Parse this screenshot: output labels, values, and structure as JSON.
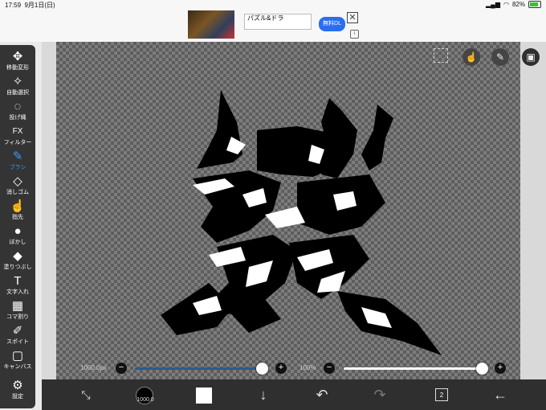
{
  "status_bar": {
    "time": "17:59",
    "date": "9月1日(日)",
    "battery": "82%"
  },
  "ad": {
    "title": "パズル&ドラ",
    "button": "無料DL",
    "close": "✕",
    "info": "i"
  },
  "tools": [
    {
      "name": "move",
      "label": "移動変形",
      "icon": "✥"
    },
    {
      "name": "magic-wand",
      "label": "自動選択",
      "icon": "✧"
    },
    {
      "name": "lasso",
      "label": "投げ縄",
      "icon": "◌"
    },
    {
      "name": "filter",
      "label": "フィルター",
      "icon": "FX"
    },
    {
      "name": "brush",
      "label": "ブラシ",
      "icon": "✎"
    },
    {
      "name": "eraser",
      "label": "消しゴム",
      "icon": "◇"
    },
    {
      "name": "finger",
      "label": "指先",
      "icon": "☝"
    },
    {
      "name": "blur",
      "label": "ぼかし",
      "icon": "●"
    },
    {
      "name": "fill",
      "label": "塗りつぶし",
      "icon": "◆"
    },
    {
      "name": "text",
      "label": "文字入れ",
      "icon": "T"
    },
    {
      "name": "panel",
      "label": "コマ割り",
      "icon": "▦"
    },
    {
      "name": "eyedropper",
      "label": "スポイト",
      "icon": "✐"
    },
    {
      "name": "canvas",
      "label": "キャンバス",
      "icon": "▢"
    },
    {
      "name": "settings",
      "label": "設定",
      "icon": "⚙"
    }
  ],
  "active_tool": "brush",
  "sliders": {
    "brush_size": {
      "label": "1000.0px",
      "level": 1.0
    },
    "opacity": {
      "label": "100%",
      "level": 1.0
    },
    "minus": "−",
    "plus": "+"
  },
  "bottom_bar": {
    "brush_size": "1000.0",
    "layer_count": "2"
  },
  "icons": {
    "top_selection": "selection-icon",
    "top_hand": "hand-icon",
    "top_pen": "pen-icon",
    "top_image": "image-icon"
  },
  "colors": {
    "accent": "#3a9cf0",
    "slider_track": "#2a5a8c",
    "primary_color": "#ffffff"
  }
}
